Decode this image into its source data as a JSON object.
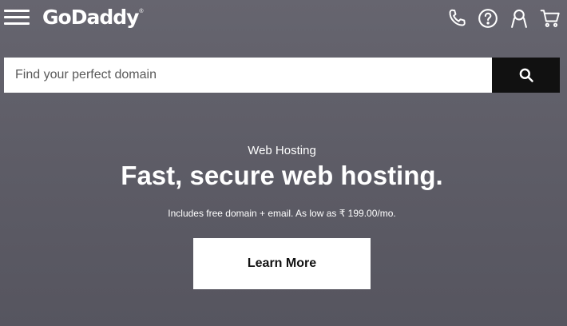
{
  "header": {
    "logo_text": "GoDaddy",
    "logo_mark": "®",
    "icons": [
      "menu-icon",
      "phone-icon",
      "help-icon",
      "account-icon",
      "cart-icon"
    ]
  },
  "search": {
    "placeholder": "Find your perfect domain",
    "value": "",
    "button_icon": "search-icon"
  },
  "hero": {
    "eyebrow": "Web Hosting",
    "title": "Fast, secure web hosting.",
    "subtitle": "Includes free domain + email. As low as ₹ 199.00/mo.",
    "cta_label": "Learn More"
  },
  "colors": {
    "background": "#5f5e68",
    "text": "#ffffff",
    "search_button": "#111111",
    "cta_background": "#ffffff",
    "cta_text": "#111111"
  }
}
